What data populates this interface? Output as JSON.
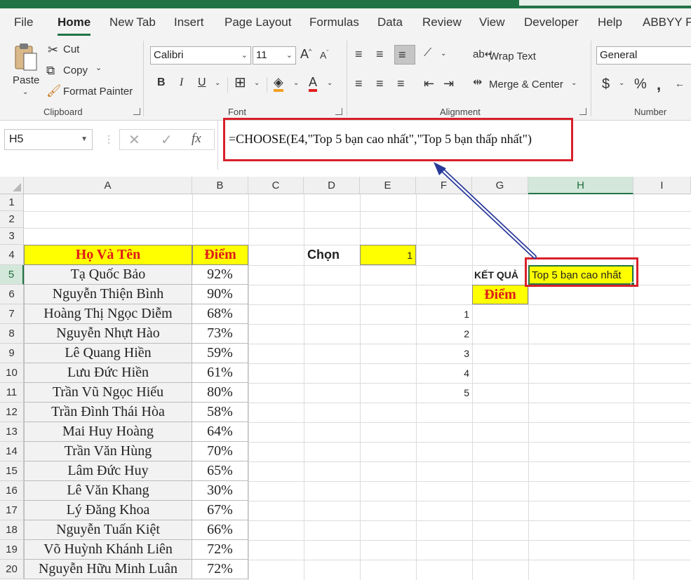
{
  "ribbon_tabs": [
    "File",
    "Home",
    "New Tab",
    "Insert",
    "Page Layout",
    "Formulas",
    "Data",
    "Review",
    "View",
    "Developer",
    "Help",
    "ABBYY Fin"
  ],
  "clipboard": {
    "paste": "Paste",
    "cut": "Cut",
    "copy": "Copy",
    "format_painter": "Format Painter",
    "label": "Clipboard"
  },
  "font": {
    "family": "Calibri",
    "size": "11",
    "label": "Font",
    "bold": "B",
    "italic": "I",
    "underline": "U"
  },
  "alignment": {
    "wrap_text": "Wrap Text",
    "merge_center": "Merge & Center",
    "label": "Alignment"
  },
  "number": {
    "format": "General",
    "label": "Number"
  },
  "formula_bar": {
    "name_box": "H5",
    "fx": "fx",
    "formula": "=CHOOSE(E4,\"Top 5 bạn cao nhất\",\"Top 5 bạn thấp nhất\")"
  },
  "columns": [
    "A",
    "B",
    "C",
    "D",
    "E",
    "F",
    "G",
    "H",
    "I"
  ],
  "rows": [
    "1",
    "2",
    "3",
    "4",
    "5",
    "6",
    "7",
    "8",
    "9",
    "10",
    "11",
    "12",
    "13",
    "14",
    "15",
    "16",
    "17",
    "18",
    "19",
    "20"
  ],
  "table": {
    "name_header": "Họ Và Tên",
    "score_header": "Điểm",
    "records": [
      {
        "name": "Tạ Quốc Bảo",
        "score": "92%"
      },
      {
        "name": "Nguyễn Thiện Bình",
        "score": "90%"
      },
      {
        "name": "Hoàng Thị Ngọc Diễm",
        "score": "68%"
      },
      {
        "name": "Nguyễn Nhựt Hào",
        "score": "73%"
      },
      {
        "name": "Lê Quang Hiền",
        "score": "59%"
      },
      {
        "name": "Lưu Đức Hiền",
        "score": "61%"
      },
      {
        "name": "Trần Vũ Ngọc Hiếu",
        "score": "80%"
      },
      {
        "name": "Trần Đình Thái Hòa",
        "score": "58%"
      },
      {
        "name": "Mai Huy Hoàng",
        "score": "64%"
      },
      {
        "name": "Trần Văn Hùng",
        "score": "70%"
      },
      {
        "name": "Lâm Đức Huy",
        "score": "65%"
      },
      {
        "name": "Lê Văn Khang",
        "score": "30%"
      },
      {
        "name": "Lý Đăng Khoa",
        "score": "67%"
      },
      {
        "name": "Nguyễn Tuấn Kiệt",
        "score": "66%"
      },
      {
        "name": "Võ Huỳnh Khánh Liên",
        "score": "72%"
      },
      {
        "name": "Nguyễn Hữu Minh Luân",
        "score": "72%"
      }
    ]
  },
  "chon_label": "Chọn",
  "chon_value": "1",
  "ket_qua_label": "KẾT QUẢ",
  "result_value": "Top 5 bạn cao nhất",
  "diem_label": "Điểm",
  "rank_numbers": [
    "1",
    "2",
    "3",
    "4",
    "5"
  ],
  "colors": {
    "accent": "#217346",
    "highlight_yellow": "#ffff00",
    "header_red": "#e01a1a",
    "callout_red": "#d8202a",
    "arrow": "#2a3a9a"
  }
}
